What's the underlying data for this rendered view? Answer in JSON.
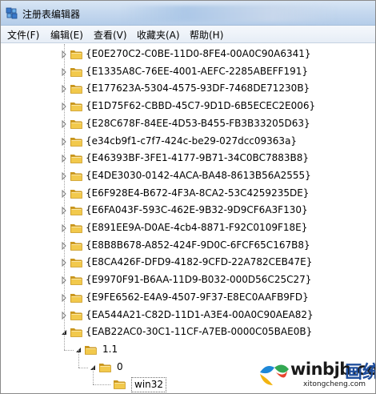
{
  "window": {
    "title": "注册表编辑器"
  },
  "menu": [
    {
      "label": "文件(F)"
    },
    {
      "label": "编辑(E)"
    },
    {
      "label": "查看(V)"
    },
    {
      "label": "收藏夹(A)"
    },
    {
      "label": "帮助(H)"
    }
  ],
  "tree": {
    "items": [
      {
        "label": "{E0E270C2-C0BE-11D0-8FE4-00A0C90A6341}",
        "level": 0,
        "expanded": false
      },
      {
        "label": "{E1335A8C-76EE-4001-AEFC-2285ABEFF191}",
        "level": 0,
        "expanded": false
      },
      {
        "label": "{E177623A-5304-4575-93DF-7468DE71230B}",
        "level": 0,
        "expanded": false
      },
      {
        "label": "{E1D75F62-CBBD-45C7-9D1D-6B5ECEC2E006}",
        "level": 0,
        "expanded": false
      },
      {
        "label": "{E28C678F-84EE-4D53-B455-FB3B33205D63}",
        "level": 0,
        "expanded": false
      },
      {
        "label": "{e34cb9f1-c7f7-424c-be29-027dcc09363a}",
        "level": 0,
        "expanded": false
      },
      {
        "label": "{E46393BF-3FE1-4177-9B71-34C0BC7883B8}",
        "level": 0,
        "expanded": false
      },
      {
        "label": "{E4DE3030-0142-4ACA-BA48-8613B56A2555}",
        "level": 0,
        "expanded": false
      },
      {
        "label": "{E6F928E4-B672-4F3A-8CA2-53C4259235DE}",
        "level": 0,
        "expanded": false
      },
      {
        "label": "{E6FA043F-593C-462E-9B32-9D9CF6A3F130}",
        "level": 0,
        "expanded": false
      },
      {
        "label": "{E891EE9A-D0AE-4cb4-8871-F92C0109F18E}",
        "level": 0,
        "expanded": false
      },
      {
        "label": "{E8B8B678-A852-424F-9D0C-6FCF65C167B8}",
        "level": 0,
        "expanded": false
      },
      {
        "label": "{E8CA426F-DFD9-4182-9CFD-22A782CEB47E}",
        "level": 0,
        "expanded": false
      },
      {
        "label": "{E9970F91-B6AA-11D9-B032-000D56C25C27}",
        "level": 0,
        "expanded": false
      },
      {
        "label": "{E9FE6562-E4A9-4507-9F37-E8EC0AAFB9FD}",
        "level": 0,
        "expanded": false
      },
      {
        "label": "{EA544A21-C82D-11D1-A3E4-00A0C90AEA82}",
        "level": 0,
        "expanded": false
      },
      {
        "label": "{EAB22AC0-30C1-11CF-A7EB-0000C05BAE0B}",
        "level": 0,
        "expanded": true
      },
      {
        "label": "1.1",
        "level": 1,
        "expanded": true
      },
      {
        "label": "0",
        "level": 2,
        "expanded": true
      },
      {
        "label": "win32",
        "level": 3,
        "expanded": false,
        "selected": true
      }
    ]
  },
  "watermark": {
    "brand": "winbjb.com",
    "chinese": "画统城",
    "url": "xitongcheng.com"
  },
  "colors": {
    "folder": "#f2c94c",
    "folder_dark": "#c9961e",
    "title_bar": "#c6d9ef",
    "watermark_blue": "#1f4e9c"
  }
}
